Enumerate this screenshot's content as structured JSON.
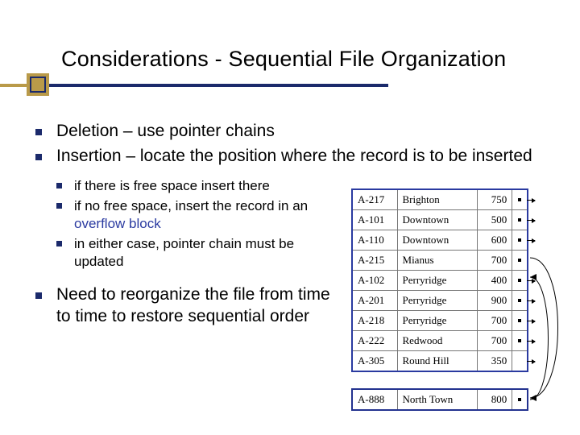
{
  "title": "Considerations - Sequential File Organization",
  "bullets": {
    "b1": "Deletion – use pointer chains",
    "b2": "Insertion – locate the position where the record is to be inserted",
    "b2_sub": {
      "s1": "if there is free space insert there",
      "s2a": "if no free space, insert the record in an ",
      "s2b": "overflow block",
      "s3": "in either case, pointer chain must be updated"
    },
    "b3": "Need to reorganize the file from time to time to restore sequential order"
  },
  "table": {
    "main": [
      {
        "id": "A-217",
        "branch": "Brighton",
        "bal": "750"
      },
      {
        "id": "A-101",
        "branch": "Downtown",
        "bal": "500"
      },
      {
        "id": "A-110",
        "branch": "Downtown",
        "bal": "600"
      },
      {
        "id": "A-215",
        "branch": "Mianus",
        "bal": "700"
      },
      {
        "id": "A-102",
        "branch": "Perryridge",
        "bal": "400"
      },
      {
        "id": "A-201",
        "branch": "Perryridge",
        "bal": "900"
      },
      {
        "id": "A-218",
        "branch": "Perryridge",
        "bal": "700"
      },
      {
        "id": "A-222",
        "branch": "Redwood",
        "bal": "700"
      },
      {
        "id": "A-305",
        "branch": "Round Hill",
        "bal": "350"
      }
    ],
    "overflow": [
      {
        "id": "A-888",
        "branch": "North Town",
        "bal": "800"
      }
    ]
  }
}
